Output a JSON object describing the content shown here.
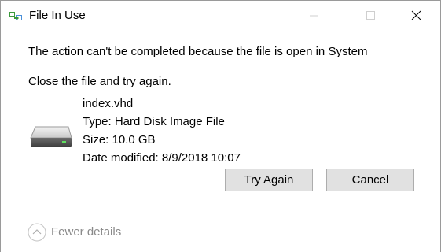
{
  "window": {
    "title": "File In Use",
    "app_icon": "file-move-icon"
  },
  "title_buttons": {
    "minimize_icon": "minimize-icon",
    "maximize_icon": "maximize-icon",
    "close_icon": "close-icon"
  },
  "message": "The action can't be completed because the file is open in System",
  "instruction": "Close the file and try again.",
  "file": {
    "icon": "hard-disk-icon",
    "name": "index.vhd",
    "type": "Type: Hard Disk Image File",
    "size": "Size: 10.0 GB",
    "date_modified": "Date modified: 8/9/2018 10:07"
  },
  "buttons": {
    "try_again": "Try Again",
    "cancel": "Cancel"
  },
  "footer": {
    "details_label": "Fewer details",
    "details_icon": "chevron-up-circle-icon"
  },
  "colors": {
    "button_bg": "#e1e1e1",
    "button_border": "#adadad",
    "muted_text": "#8a8a8a"
  }
}
